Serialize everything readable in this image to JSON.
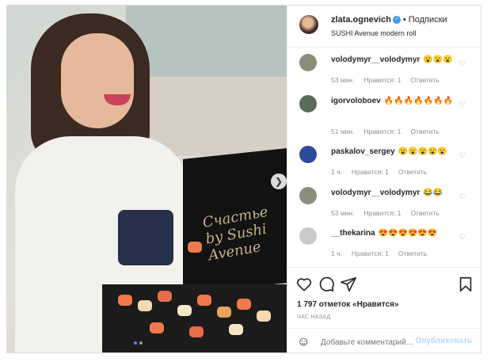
{
  "post": {
    "author": "zlata.ognevich",
    "follow_label": "Подписки",
    "caption": "SUSHI Avenue modern roll",
    "image_text": "Счастье by Sushi Avenue"
  },
  "comments": [
    {
      "user": "volodymyr__volodymyr",
      "text": "😮😮😮",
      "time": "53 мин.",
      "likes": "Нравится: 1",
      "reply": "Ответить"
    },
    {
      "user": "igorvoloboev",
      "text": "🔥🔥🔥🔥🔥🔥🔥",
      "time": "51 мин.",
      "likes": "Нравится: 1",
      "reply": "Ответить"
    },
    {
      "user": "paskalov_sergey",
      "text": "😮😮😮😮😮",
      "time": "1 ч.",
      "likes": "Нравится: 1",
      "reply": "Ответить"
    },
    {
      "user": "volodymyr__volodymyr",
      "text": "😂😂",
      "time": "53 мин.",
      "likes": "Нравится: 1",
      "reply": "Ответить"
    },
    {
      "user": "__thekarina",
      "text": "😍😍😍😍😍😍",
      "time": "1 ч.",
      "likes": "Нравится: 1",
      "reply": "Ответить"
    }
  ],
  "stats": {
    "likes_text": "1 797 отметок «Нравится»",
    "time_text": "ЧАС НАЗАД"
  },
  "add_comment": {
    "placeholder": "Добавьте комментарий...",
    "publish_label": "Опубликовать"
  },
  "icons": {
    "verified": "verified-badge-icon",
    "like": "heart-icon",
    "comment": "comment-icon",
    "share": "share-icon",
    "save": "bookmark-icon",
    "emoji": "smile-icon",
    "next": "chevron-right-icon"
  },
  "colors": {
    "accent": "#3897f0",
    "text": "#262626",
    "muted": "#8e8e8e",
    "publish_disabled": "#b3dbff"
  }
}
